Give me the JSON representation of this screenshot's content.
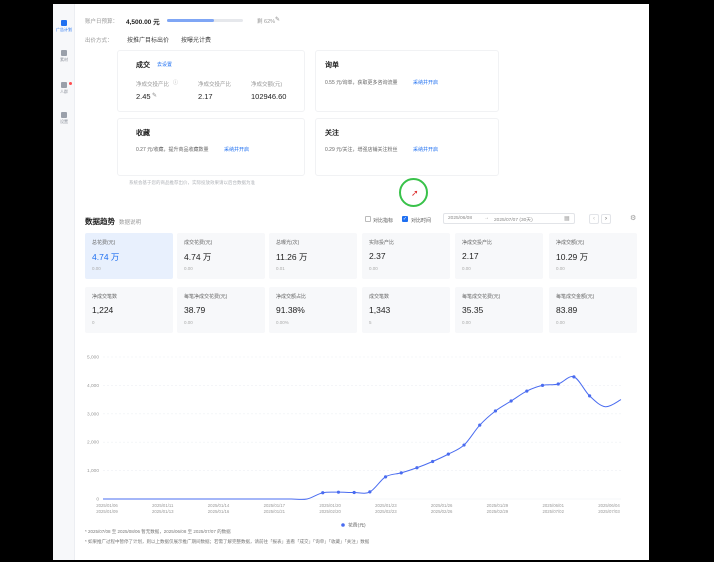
{
  "sidebar": {
    "items": [
      {
        "label": "广告计划"
      },
      {
        "label": "素材"
      },
      {
        "label": "人群"
      },
      {
        "label": "设置"
      }
    ]
  },
  "header": {
    "budget_label": "账户日预算：",
    "budget_value": "4,500.00 元",
    "budget_progress": 0.62,
    "budget_pct": "剩 62%",
    "bid_label": "出价方式：",
    "bid_opt1": "按推广目标出价",
    "bid_opt2": "按曝光计费"
  },
  "cards": {
    "deal": {
      "title": "成交",
      "link": "去设置",
      "metrics": [
        {
          "label": "净成交投产比",
          "value": "2.45"
        },
        {
          "label": "净成交投产比",
          "value": "2.17"
        },
        {
          "label": "净成交额(元)",
          "value": "102946.60"
        }
      ]
    },
    "order": {
      "title": "询单",
      "desc": "0.55 元/询单，获取更多咨询流量",
      "link": "采纳并开启"
    },
    "collect": {
      "title": "收藏",
      "desc": "0.27 元/收藏，提升商品收藏数量",
      "link": "采纳并开启"
    },
    "follow": {
      "title": "关注",
      "desc": "0.29 元/关注，增强店铺关注粉丝",
      "link": "采纳并开启"
    },
    "footnote": "系统会基于您的商品推荐出价，实际投放效果请以后台数据为准"
  },
  "trend": {
    "title": "数据趋势",
    "subtitle": "数据说明",
    "compare_label": "对比指标",
    "period_label": "对比时间",
    "date_start": "2025/06/08",
    "date_end": "2025/07/07 (30天)",
    "tiles": [
      {
        "label": "总花费(元)",
        "value": "4.74 万",
        "sub": "0.00"
      },
      {
        "label": "成交花费(元)",
        "value": "4.74 万",
        "sub": "0.00"
      },
      {
        "label": "总曝光(次)",
        "value": "11.26 万",
        "sub": "0.01"
      },
      {
        "label": "实际投产比",
        "value": "2.37",
        "sub": "0.00"
      },
      {
        "label": "净成交投产比",
        "value": "2.17",
        "sub": "0.00"
      },
      {
        "label": "净成交额(元)",
        "value": "10.29 万",
        "sub": "0.00"
      },
      {
        "label": "净成交笔数",
        "value": "1,224",
        "sub": "0"
      },
      {
        "label": "每笔净成交花费(元)",
        "value": "38.79",
        "sub": "0.00"
      },
      {
        "label": "净成交额占比",
        "value": "91.38%",
        "sub": "0.00%"
      },
      {
        "label": "成交笔数",
        "value": "1,343",
        "sub": "5"
      },
      {
        "label": "每笔成交花费(元)",
        "value": "35.35",
        "sub": "0.00"
      },
      {
        "label": "每笔成交金额(元)",
        "value": "83.89",
        "sub": "0.00"
      }
    ]
  },
  "chart_data": {
    "type": "line",
    "title": "",
    "xlabel": "",
    "ylabel": "",
    "ylim": [
      0,
      5000
    ],
    "y_ticks": [
      "0",
      "1,000",
      "2,000",
      "3,000",
      "4,000",
      "5,000"
    ],
    "x_tick_labels": [
      [
        "2025/01/06",
        "2025/01/09"
      ],
      [
        "2025/01/11",
        "2025/01/13"
      ],
      [
        "2025/01/14",
        "2025/01/16"
      ],
      [
        "2025/01/17",
        "2025/01/21"
      ],
      [
        "2025/01/20",
        "2025/02/20"
      ],
      [
        "2025/01/23",
        "2025/02/23"
      ],
      [
        "2025/01/26",
        "2025/02/26"
      ],
      [
        "2025/01/29",
        "2025/02/29"
      ],
      [
        "2025/06/01",
        "2025/07/02"
      ],
      [
        "2025/06/04",
        "2025/07/03"
      ]
    ],
    "series": [
      {
        "name": "花费(元)",
        "color": "#4a6cf0",
        "x": [
          0,
          1,
          2,
          3,
          4,
          5,
          6,
          7,
          8,
          9,
          10,
          11,
          12,
          13,
          14,
          15,
          16,
          17,
          18,
          19,
          20,
          21,
          22,
          23,
          24,
          25,
          26,
          27,
          28,
          29,
          30,
          31,
          32,
          33
        ],
        "values": [
          0,
          0,
          0,
          0,
          0,
          0,
          0,
          0,
          0,
          0,
          0,
          0,
          0,
          0,
          220,
          240,
          230,
          250,
          780,
          920,
          1100,
          1320,
          1580,
          1900,
          2600,
          3100,
          3450,
          3800,
          4000,
          4050,
          4300,
          3630,
          3250,
          3500
        ],
        "markers_until": 31
      }
    ],
    "legend_position": "bottom"
  },
  "notes": {
    "line1": "* 2025/07/08 至 2025/08/06 暂无数据，2025/06/08 至 2025/07/07 的数据",
    "line2": "* 如果推广过程中暂停了计划，则以上数据仅展示推广期间数据；若需了解完整数据，请前往「报表」查看「成交」「询单」「收藏」「关注」数据"
  },
  "cursor": {
    "ring_color": "#39c24a"
  }
}
